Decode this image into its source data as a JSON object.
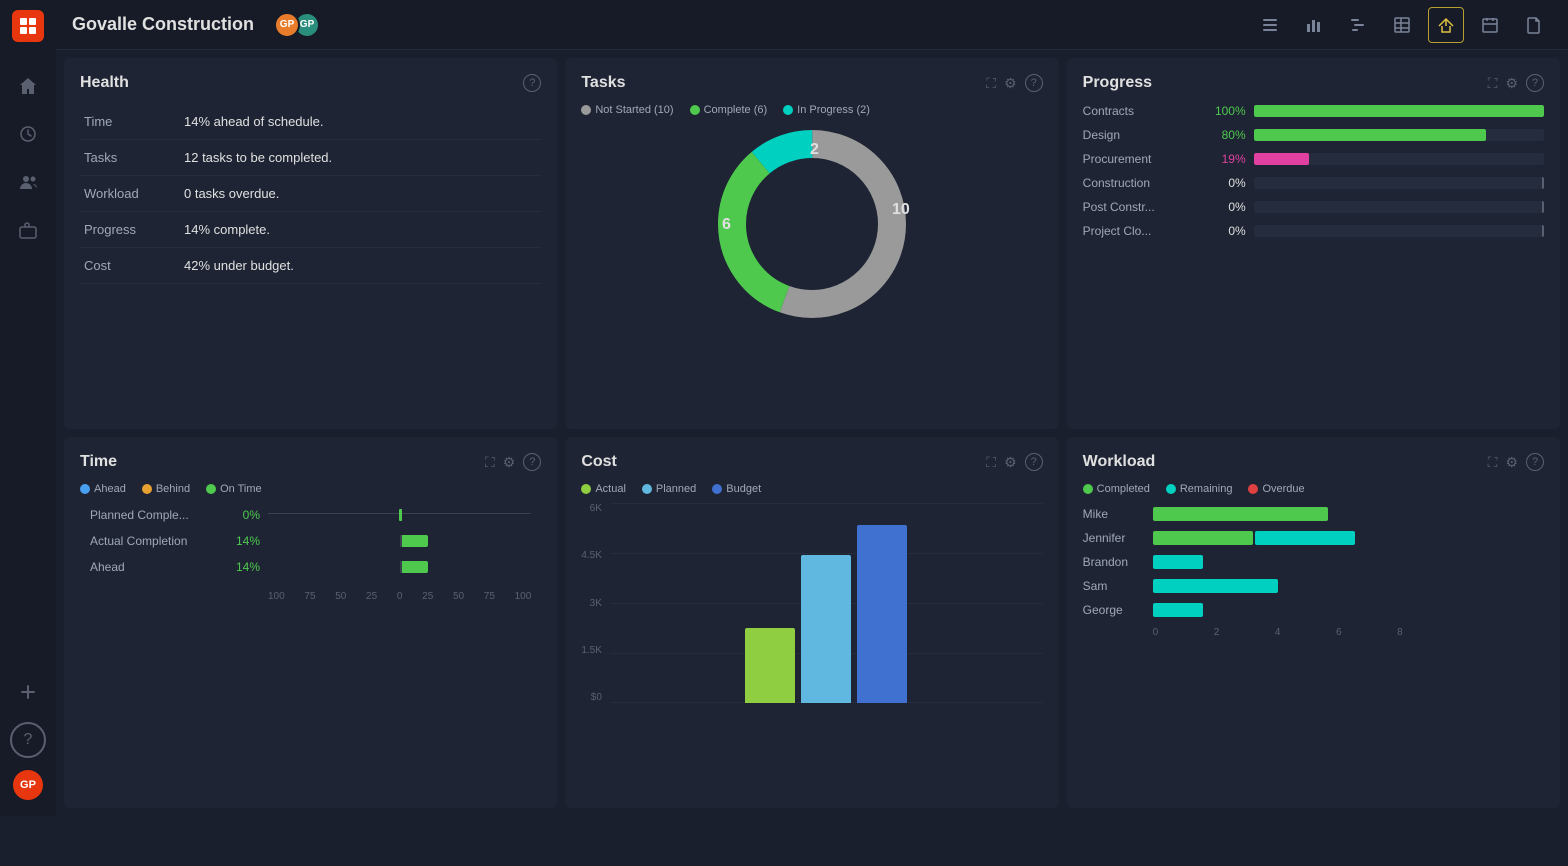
{
  "app": {
    "logo": "PM",
    "title": "Govalle Construction"
  },
  "topbar": {
    "icons": [
      {
        "name": "list-icon",
        "label": "List view",
        "active": false
      },
      {
        "name": "bar-chart-icon",
        "label": "Bar chart view",
        "active": false
      },
      {
        "name": "gantt-icon",
        "label": "Gantt view",
        "active": false
      },
      {
        "name": "table-icon",
        "label": "Table view",
        "active": false
      },
      {
        "name": "dashboard-icon",
        "label": "Dashboard view",
        "active": true
      },
      {
        "name": "calendar-icon",
        "label": "Calendar view",
        "active": false
      },
      {
        "name": "document-icon",
        "label": "Document view",
        "active": false
      }
    ],
    "avatars": [
      {
        "initials": "GP",
        "color": "orange"
      },
      {
        "initials": "GP",
        "color": "teal"
      }
    ]
  },
  "health": {
    "title": "Health",
    "rows": [
      {
        "label": "Time",
        "value": "14% ahead of schedule."
      },
      {
        "label": "Tasks",
        "value": "12 tasks to be completed."
      },
      {
        "label": "Workload",
        "value": "0 tasks overdue."
      },
      {
        "label": "Progress",
        "value": "14% complete."
      },
      {
        "label": "Cost",
        "value": "42% under budget."
      }
    ]
  },
  "tasks": {
    "title": "Tasks",
    "legend": [
      {
        "label": "Not Started (10)",
        "color": "#9a9a9a"
      },
      {
        "label": "Complete (6)",
        "color": "#4ec94e"
      },
      {
        "label": "In Progress (2)",
        "color": "#00d0c0"
      }
    ],
    "donut": {
      "not_started": 10,
      "complete": 6,
      "in_progress": 2,
      "total": 18,
      "label_left": "6",
      "label_top": "2",
      "label_right": "10"
    }
  },
  "progress": {
    "title": "Progress",
    "rows": [
      {
        "label": "Contracts",
        "pct": "100%",
        "fill": 100,
        "color": "#4ec94e"
      },
      {
        "label": "Design",
        "pct": "80%",
        "fill": 80,
        "color": "#4ec94e"
      },
      {
        "label": "Procurement",
        "pct": "19%",
        "fill": 19,
        "color": "#e040a0"
      },
      {
        "label": "Construction",
        "pct": "0%",
        "fill": 0,
        "color": "#4ec94e",
        "marker": true
      },
      {
        "label": "Post Constr...",
        "pct": "0%",
        "fill": 0,
        "color": "#4ec94e",
        "marker": true
      },
      {
        "label": "Project Clo...",
        "pct": "0%",
        "fill": 0,
        "color": "#4ec94e",
        "marker": true
      }
    ]
  },
  "time": {
    "title": "Time",
    "legend": [
      {
        "label": "Ahead",
        "color": "#4a9ef0"
      },
      {
        "label": "Behind",
        "color": "#e8a030"
      },
      {
        "label": "On Time",
        "color": "#4ec94e"
      }
    ],
    "rows": [
      {
        "label": "Planned Comple...",
        "pct": "0%",
        "value": 0,
        "color": "#4ec94e"
      },
      {
        "label": "Actual Completion",
        "pct": "14%",
        "value": 14,
        "color": "#4ec94e"
      },
      {
        "label": "Ahead",
        "pct": "14%",
        "value": 14,
        "color": "#4ec94e"
      }
    ],
    "axis": [
      "100",
      "75",
      "50",
      "25",
      "0",
      "25",
      "50",
      "75",
      "100"
    ]
  },
  "cost": {
    "title": "Cost",
    "legend": [
      {
        "label": "Actual",
        "color": "#8ece40"
      },
      {
        "label": "Planned",
        "color": "#60b8e0"
      },
      {
        "label": "Budget",
        "color": "#4070d0"
      }
    ],
    "y_labels": [
      "6K",
      "4.5K",
      "3K",
      "1.5K",
      "$0"
    ],
    "bars": {
      "actual_height": 75,
      "planned_height": 145,
      "budget_height": 175
    }
  },
  "workload": {
    "title": "Workload",
    "legend": [
      {
        "label": "Completed",
        "color": "#4ec94e"
      },
      {
        "label": "Remaining",
        "color": "#00d0c0"
      },
      {
        "label": "Overdue",
        "color": "#e04040"
      }
    ],
    "rows": [
      {
        "label": "Mike",
        "completed": 7,
        "remaining": 0,
        "overdue": 0
      },
      {
        "label": "Jennifer",
        "completed": 4,
        "remaining": 4,
        "overdue": 0
      },
      {
        "label": "Brandon",
        "completed": 0,
        "remaining": 2,
        "overdue": 0
      },
      {
        "label": "Sam",
        "completed": 0,
        "remaining": 5,
        "overdue": 0
      },
      {
        "label": "George",
        "completed": 0,
        "remaining": 2,
        "overdue": 0
      }
    ],
    "axis": [
      "0",
      "2",
      "4",
      "6",
      "8"
    ]
  },
  "sidebar": {
    "items": [
      {
        "name": "home",
        "icon": "home"
      },
      {
        "name": "history",
        "icon": "clock"
      },
      {
        "name": "people",
        "icon": "people"
      },
      {
        "name": "briefcase",
        "icon": "briefcase"
      }
    ]
  }
}
